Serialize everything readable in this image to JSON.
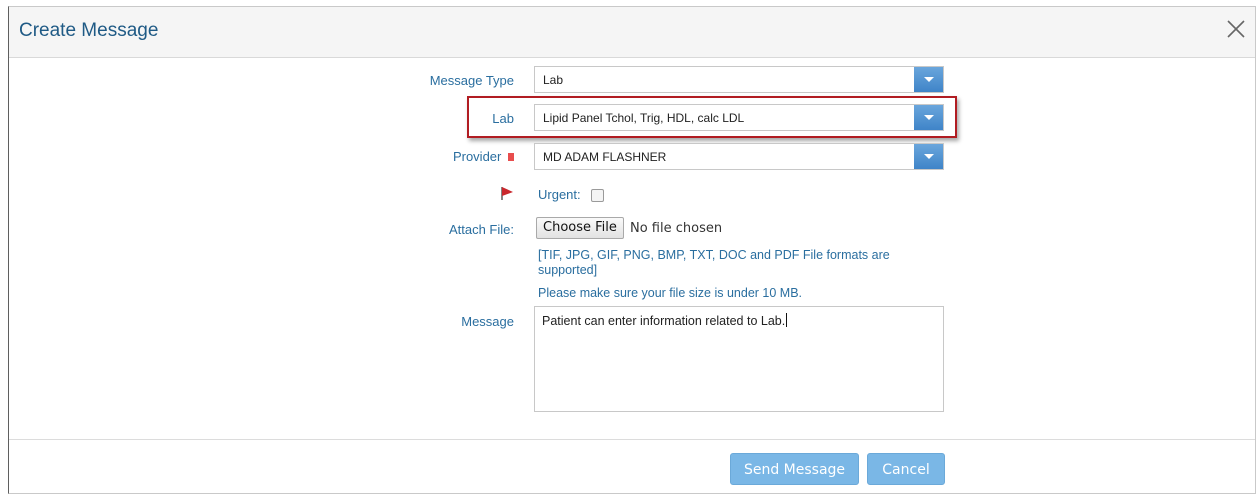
{
  "dialog": {
    "title": "Create Message",
    "close_icon": "close-icon"
  },
  "form": {
    "message_type": {
      "label": "Message Type",
      "value": "Lab"
    },
    "lab": {
      "label": "Lab",
      "value": "Lipid Panel Tchol, Trig, HDL, calc LDL"
    },
    "provider": {
      "label": "Provider",
      "value": "MD ADAM FLASHNER",
      "required_color": "#e84d4d"
    },
    "urgent": {
      "label": "Urgent:",
      "checked": false,
      "flag_icon": "red-flag-icon"
    },
    "attach": {
      "label": "Attach File:",
      "button_label": "Choose File",
      "status": "No file chosen",
      "formats_line1": "[TIF, JPG, GIF, PNG, BMP, TXT, DOC and PDF File formats are",
      "formats_line2": "supported]",
      "size_note": "Please make sure your file size is under 10 MB."
    },
    "message": {
      "label": "Message",
      "value": "Patient can enter information related to Lab."
    }
  },
  "footer": {
    "send_label": "Send Message",
    "cancel_label": "Cancel"
  },
  "colors": {
    "label": "#2a6e9f",
    "title": "#1f5a85",
    "button": "#7ab7e6",
    "highlight": "#b11c22",
    "select_button": "#4f92d2"
  }
}
